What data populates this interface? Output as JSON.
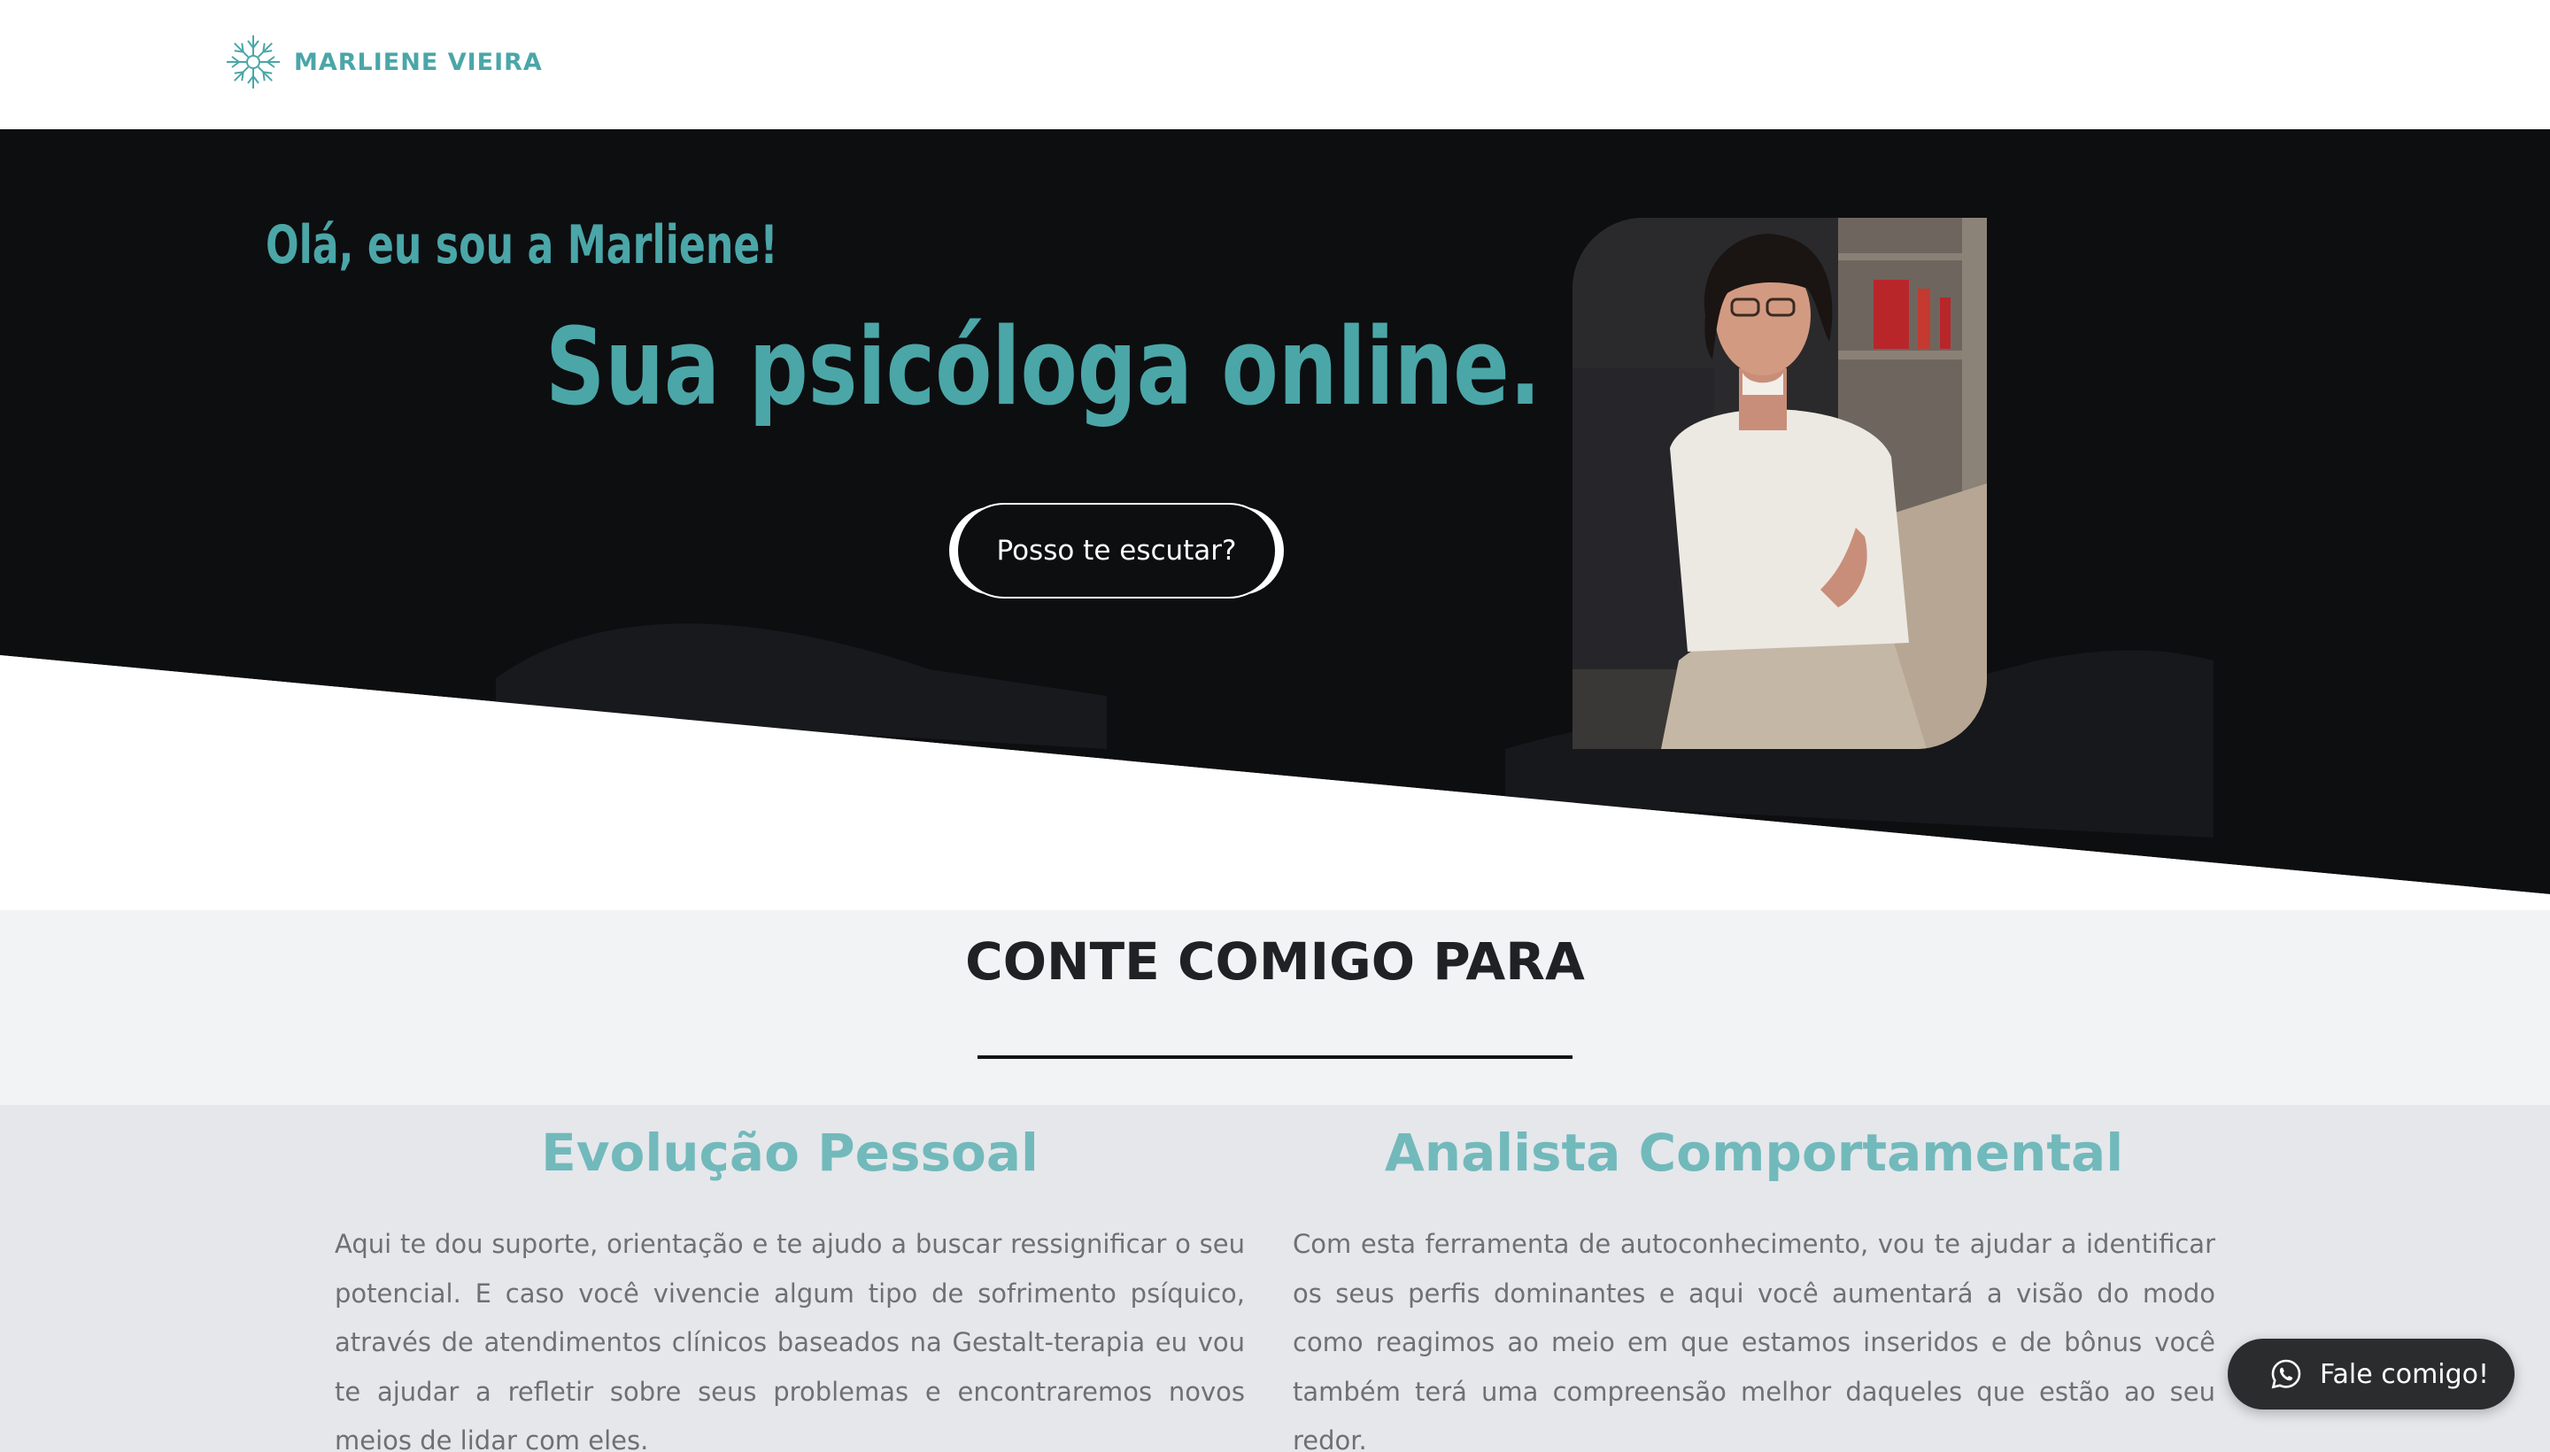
{
  "header": {
    "logo_text": "MARLIENE VIEIRA"
  },
  "hero": {
    "greeting": "Olá, eu sou a Marliene!",
    "headline": "Sua psicóloga online.",
    "cta_label": "Posso te escutar?",
    "photo_icon": "portrait-photo"
  },
  "section": {
    "title": "CONTE COMIGO PARA"
  },
  "services": [
    {
      "title": "Evolução Pessoal",
      "text": "Aqui te dou suporte, orientação e te ajudo a buscar ressignificar o seu potencial. E caso você vivencie algum tipo de sofrimento psíquico, através de atendimentos clínicos baseados na Gestalt-terapia eu vou te ajudar a refletir sobre seus problemas e encontraremos novos meios de lidar com eles."
    },
    {
      "title": "Analista Comportamental",
      "text": "Com esta ferramenta de autoconhecimento, vou te ajudar a identificar os seus perfis dominantes e aqui você aumentará a visão do modo como reagimos ao meio em que estamos inseridos e de bônus você também terá uma compreensão melhor daqueles que estão ao seu redor."
    }
  ],
  "fab": {
    "label": "Fale comigo!",
    "icon": "whatsapp-icon"
  },
  "colors": {
    "accent": "#4ba6a8",
    "hero_bg": "#0d0e10",
    "section_bg": "#f2f3f5",
    "services_bg": "#e5e7eb"
  }
}
